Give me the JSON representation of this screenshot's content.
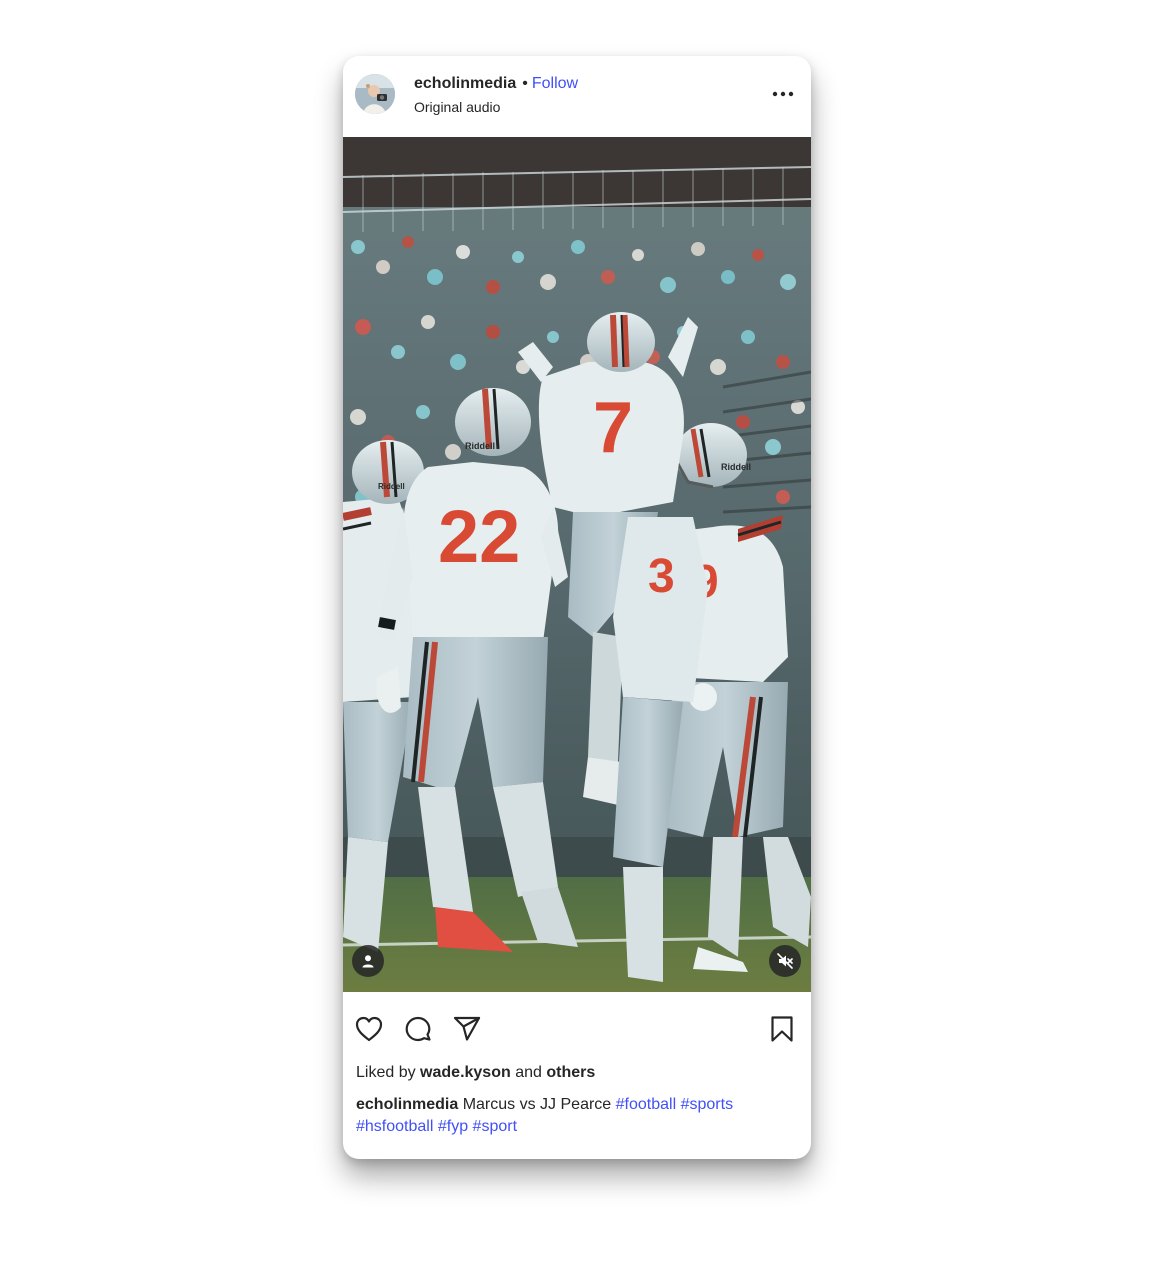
{
  "post": {
    "username": "echolinmedia",
    "separator": "•",
    "follow_label": "Follow",
    "audio_label": "Original audio",
    "likes": {
      "prefix": "Liked by",
      "user": "wade.kyson",
      "middle": "and",
      "others": "others"
    },
    "caption": {
      "username": "echolinmedia",
      "text": "Marcus vs JJ Pearce",
      "hashtags": [
        "#football",
        "#sports",
        "#hsfootball",
        "#fyp",
        "#sport"
      ]
    },
    "media": {
      "jersey_numbers": [
        "7",
        "22",
        "3",
        "9"
      ],
      "helmet_text": "Riddell"
    }
  },
  "icons": {
    "more": "more-options-icon",
    "tag": "user-tag-icon",
    "mute": "speaker-muted-icon",
    "like": "heart-icon",
    "comment": "comment-icon",
    "share": "send-icon",
    "save": "bookmark-icon"
  },
  "colors": {
    "link": "#4150f7",
    "text": "#262626",
    "jersey_number": "#e1432d"
  }
}
